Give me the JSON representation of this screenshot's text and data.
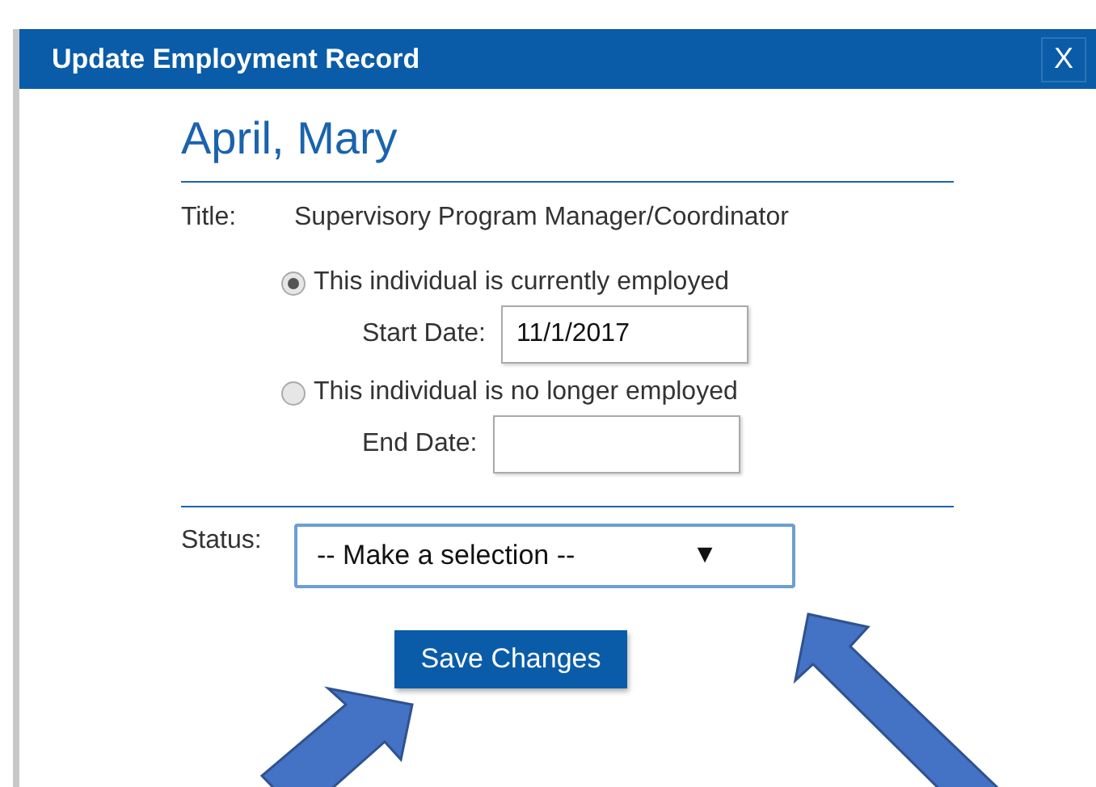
{
  "dialog": {
    "title": "Update Employment Record",
    "close": "X"
  },
  "person_name": "April, Mary",
  "title_field": {
    "label": "Title:",
    "value": "Supervisory Program Manager/Coordinator"
  },
  "employment_options": [
    {
      "label": "This individual is currently employed",
      "selected": true,
      "date_label": "Start Date:",
      "date_value": "11/1/2017"
    },
    {
      "label": "This individual is no longer employed",
      "selected": false,
      "date_label": "End Date:"
    }
  ],
  "status": {
    "label": "Status:",
    "value": "-- Make a selection --",
    "caret": "▼"
  },
  "save_button": "Save Changes"
}
